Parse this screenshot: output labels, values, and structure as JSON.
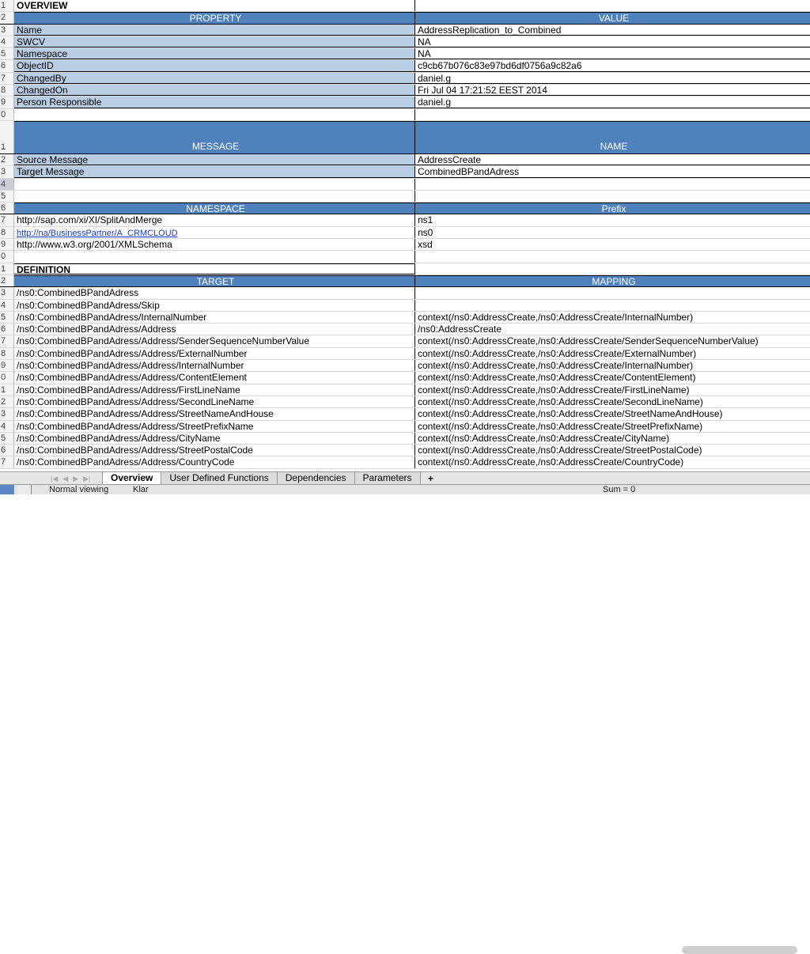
{
  "sheet": {
    "section1_title": "OVERVIEW",
    "prop_header": [
      "PROPERTY",
      "VALUE"
    ],
    "properties": [
      {
        "rn": "3",
        "k": "Name",
        "v": "AddressReplication_to_Combined"
      },
      {
        "rn": "4",
        "k": "SWCV",
        "v": "NA"
      },
      {
        "rn": "5",
        "k": "Namespace",
        "v": "NA"
      },
      {
        "rn": "6",
        "k": "ObjectID",
        "v": "c9cb67b076c83e97bd6df0756a9c82a6"
      },
      {
        "rn": "7",
        "k": "ChangedBy",
        "v": "daniel.g"
      },
      {
        "rn": "8",
        "k": "ChangedOn",
        "v": "Fri Jul 04 17:21:52 EEST 2014"
      },
      {
        "rn": "9",
        "k": "Person Responsible",
        "v": "daniel.g"
      }
    ],
    "msg_header": [
      "MESSAGE",
      "NAME"
    ],
    "messages": [
      {
        "rn": "2",
        "k": "Source Message",
        "v": "AddressCreate"
      },
      {
        "rn": "3",
        "k": "Target Message",
        "v": "CombinedBPandAdress"
      }
    ],
    "ns_header": [
      "NAMESPACE",
      "Prefix"
    ],
    "namespaces": [
      {
        "rn": "7",
        "k": "http://sap.com/xi/XI/SplitAndMerge",
        "v": "ns1",
        "link": false
      },
      {
        "rn": "8",
        "k": "http://na/BusinessPartner/A_CRMCLOUD",
        "v": "ns0",
        "link": true
      },
      {
        "rn": "9",
        "k": "http://www.w3.org/2001/XMLSchema",
        "v": "xsd",
        "link": false
      }
    ],
    "section2_title": "DEFINITION",
    "def_header": [
      "TARGET",
      "MAPPING"
    ],
    "definitions": [
      {
        "rn": "3",
        "k": "/ns0:CombinedBPandAdress",
        "v": ""
      },
      {
        "rn": "4",
        "k": "/ns0:CombinedBPandAdress/Skip",
        "v": ""
      },
      {
        "rn": "5",
        "k": "/ns0:CombinedBPandAdress/InternalNumber",
        "v": "context(/ns0:AddressCreate,/ns0:AddressCreate/InternalNumber)"
      },
      {
        "rn": "6",
        "k": "/ns0:CombinedBPandAdress/Address",
        "v": "/ns0:AddressCreate"
      },
      {
        "rn": "7",
        "k": "/ns0:CombinedBPandAdress/Address/SenderSequenceNumberValue",
        "v": "context(/ns0:AddressCreate,/ns0:AddressCreate/SenderSequenceNumberValue)"
      },
      {
        "rn": "8",
        "k": "/ns0:CombinedBPandAdress/Address/ExternalNumber",
        "v": "context(/ns0:AddressCreate,/ns0:AddressCreate/ExternalNumber)"
      },
      {
        "rn": "9",
        "k": "/ns0:CombinedBPandAdress/Address/InternalNumber",
        "v": "context(/ns0:AddressCreate,/ns0:AddressCreate/InternalNumber)"
      },
      {
        "rn": "0",
        "k": "/ns0:CombinedBPandAdress/Address/ContentElement",
        "v": "context(/ns0:AddressCreate,/ns0:AddressCreate/ContentElement)"
      },
      {
        "rn": "1",
        "k": "/ns0:CombinedBPandAdress/Address/FirstLineName",
        "v": "context(/ns0:AddressCreate,/ns0:AddressCreate/FirstLineName)"
      },
      {
        "rn": "2",
        "k": "/ns0:CombinedBPandAdress/Address/SecondLineName",
        "v": "context(/ns0:AddressCreate,/ns0:AddressCreate/SecondLineName)"
      },
      {
        "rn": "3",
        "k": "/ns0:CombinedBPandAdress/Address/StreetNameAndHouse",
        "v": "context(/ns0:AddressCreate,/ns0:AddressCreate/StreetNameAndHouse)"
      },
      {
        "rn": "4",
        "k": "/ns0:CombinedBPandAdress/Address/StreetPrefixName",
        "v": "context(/ns0:AddressCreate,/ns0:AddressCreate/StreetPrefixName)"
      },
      {
        "rn": "5",
        "k": "/ns0:CombinedBPandAdress/Address/CityName",
        "v": "context(/ns0:AddressCreate,/ns0:AddressCreate/CityName)"
      },
      {
        "rn": "6",
        "k": "/ns0:CombinedBPandAdress/Address/StreetPostalCode",
        "v": "context(/ns0:AddressCreate,/ns0:AddressCreate/StreetPostalCode)"
      },
      {
        "rn": "7",
        "k": "/ns0:CombinedBPandAdress/Address/CountryCode",
        "v": "context(/ns0:AddressCreate,/ns0:AddressCreate/CountryCode)"
      }
    ]
  },
  "tabs": [
    "Overview",
    "User Defined Functions",
    "Dependencies",
    "Parameters"
  ],
  "active_tab": "Overview",
  "status": {
    "view": "Normal viewing",
    "ready": "Klar",
    "sum": "Sum = 0"
  },
  "colors": {
    "header_blue": "#4f81bd",
    "prop_blue": "#b8cce4"
  }
}
